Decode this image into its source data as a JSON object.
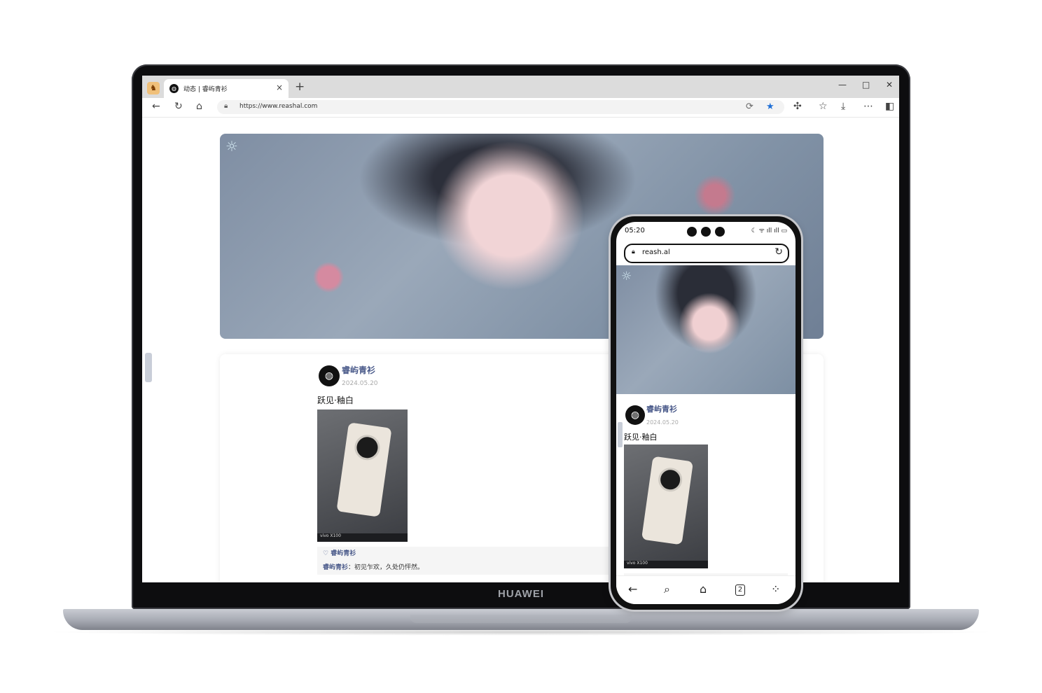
{
  "device": {
    "laptop_brand": "HUAWEI"
  },
  "browser": {
    "tab_title": "动态 | 睿屿青衫",
    "tab_close": "×",
    "new_tab": "+",
    "url": "https://www.reashal.com",
    "icons": {
      "app": "app-logo-icon",
      "back": "back-arrow-icon",
      "reload": "reload-icon",
      "home": "home-icon",
      "lock": "lock-icon",
      "favorite": "star-icon",
      "extensions": "puzzle-icon",
      "collections": "favorites-list-icon",
      "download": "download-icon",
      "more": "more-icon",
      "sidebar": "sidebar-icon"
    },
    "window_controls": {
      "minimize": "—",
      "maximize": "□",
      "close": "✕"
    }
  },
  "post": {
    "author": "睿屿青衫",
    "date": "2024.05.20",
    "text": "跃见·釉白",
    "photo_caption": "vivo X100",
    "like_prefix": "♡",
    "like_user": "睿屿青衫",
    "comment_user": "睿屿青衫",
    "comment_text": "：初见乍欢，久处仍怦然。"
  },
  "phone": {
    "time": "05:20",
    "url": "reash.al",
    "tabs_count": "2"
  },
  "colors": {
    "author": "#4a5a8a",
    "accent_star": "#1f6fd6"
  }
}
